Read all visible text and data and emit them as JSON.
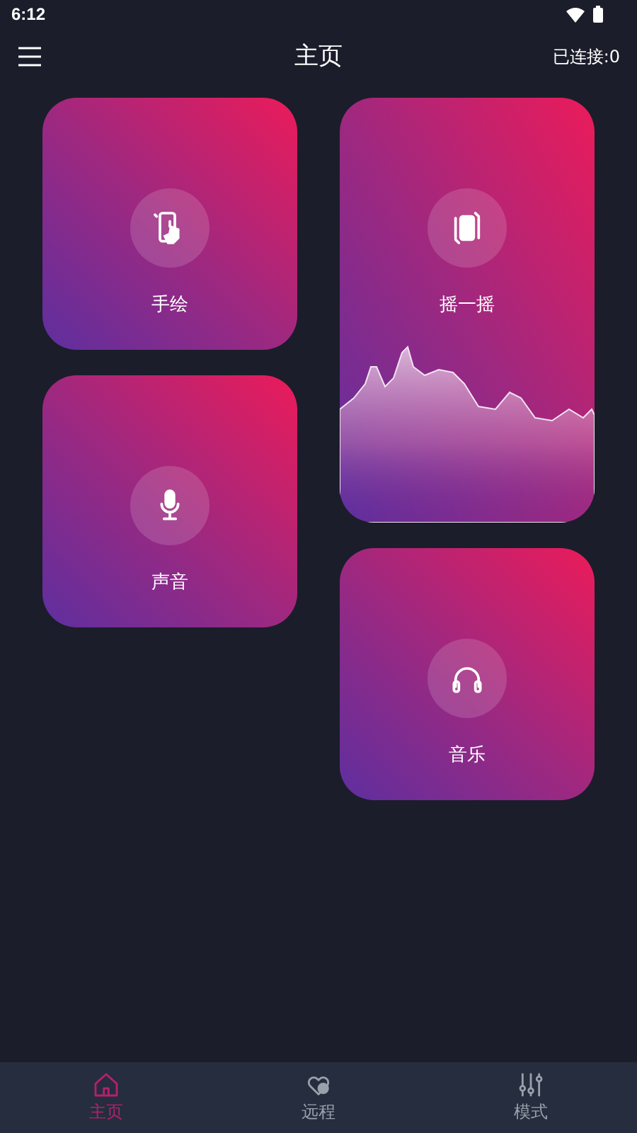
{
  "status_bar": {
    "time": "6:12"
  },
  "app_bar": {
    "title": "主页",
    "connection": "已连接:0"
  },
  "columns": [
    {
      "cards": [
        {
          "label": "手绘",
          "kind": "touch"
        },
        {
          "label": "声音",
          "kind": "mic"
        }
      ]
    },
    {
      "cards": [
        {
          "label": "摇一摇",
          "kind": "shake"
        },
        {
          "label": "音乐",
          "kind": "headphones"
        }
      ]
    }
  ],
  "nav": [
    {
      "label": "主页",
      "kind": "home",
      "selected": true
    },
    {
      "label": "远程",
      "kind": "heart",
      "selected": false
    },
    {
      "label": "模式",
      "kind": "sliders",
      "selected": false
    }
  ]
}
